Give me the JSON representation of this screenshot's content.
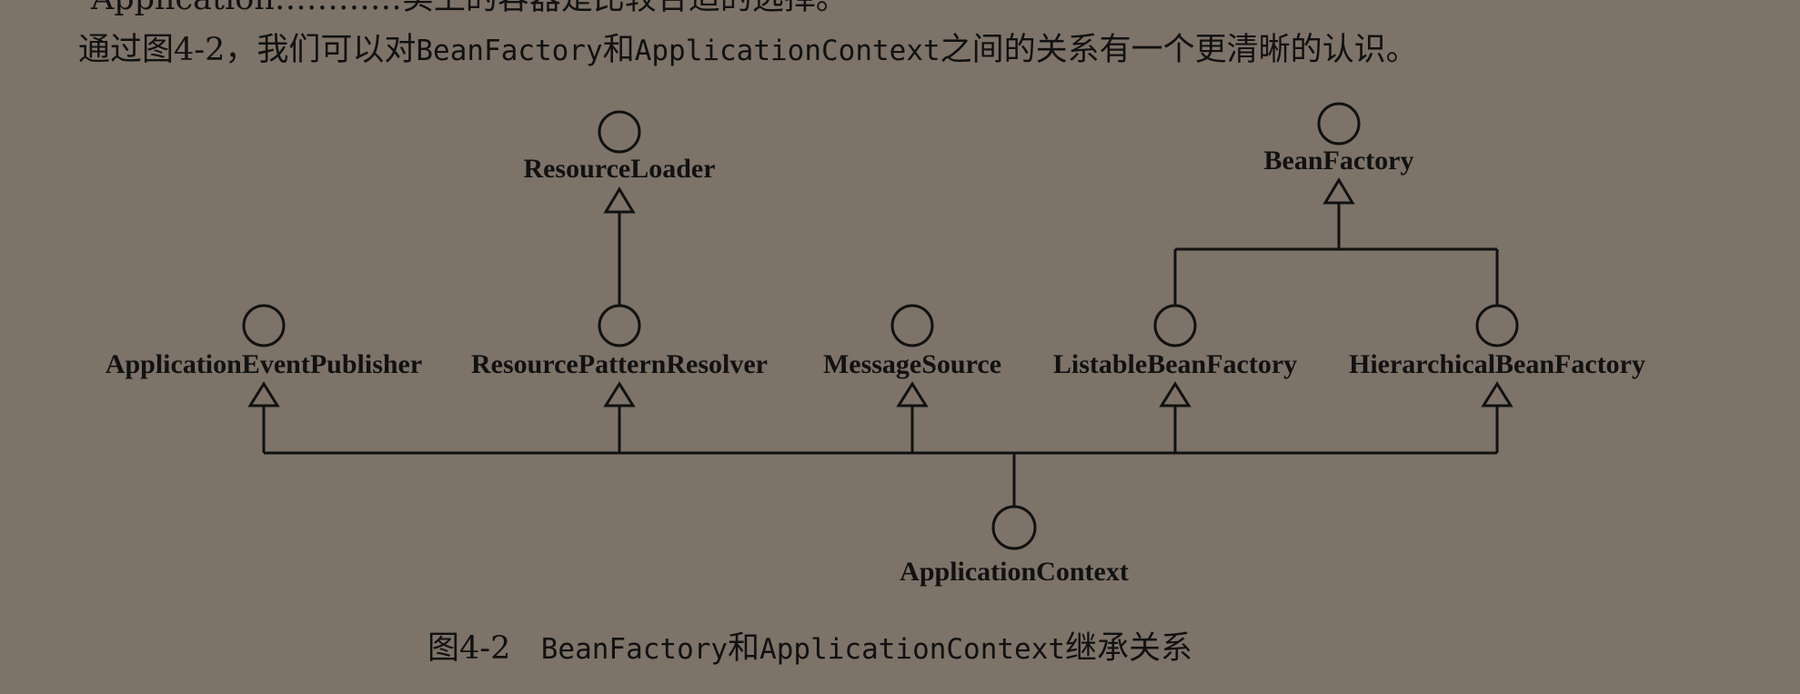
{
  "text": {
    "top_partial": "Application…………实上的容器是比较合适的选择。",
    "intro_a": "通过图4-2，我们可以对",
    "intro_b": "BeanFactory",
    "intro_c": "和",
    "intro_d": "ApplicationContext",
    "intro_e": "之间的关系有一个更清晰的认识。",
    "caption_a": "图4-2",
    "caption_b": "BeanFactory",
    "caption_c": "和",
    "caption_d": "ApplicationContext",
    "caption_e": "继承关系"
  },
  "nodes": {
    "resource_loader": "ResourceLoader",
    "bean_factory": "BeanFactory",
    "application_event_publisher": "ApplicationEventPublisher",
    "resource_pattern_resolver": "ResourcePatternResolver",
    "message_source": "MessageSource",
    "listable_bean_factory": "ListableBeanFactory",
    "hierarchical_bean_factory": "HierarchicalBeanFactory",
    "application_context": "ApplicationContext"
  }
}
